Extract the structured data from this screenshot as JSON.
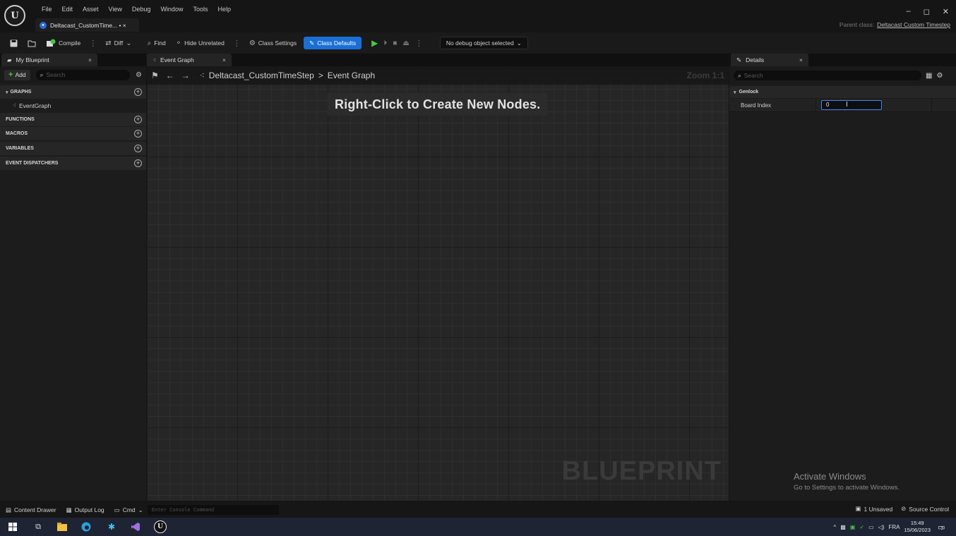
{
  "app": {
    "logo_text": "U",
    "menu": [
      "File",
      "Edit",
      "Asset",
      "View",
      "Debug",
      "Window",
      "Tools",
      "Help"
    ],
    "document_tab": "Deltacast_CustomTime... • ×",
    "parent_class_label": "Parent class:",
    "parent_class_value": "Deltacast Custom Timestep",
    "window_controls": {
      "minimize": "–",
      "restore": "◻",
      "close": "✕"
    }
  },
  "toolbar": {
    "compile": "Compile",
    "diff": "Diff",
    "find": "Find",
    "hide_unrelated": "Hide Unrelated",
    "class_settings": "Class Settings",
    "class_defaults": "Class Defaults",
    "debug_object": "No debug object selected"
  },
  "left_panel": {
    "tab": "My Blueprint",
    "add": "Add",
    "search_placeholder": "Search",
    "sections": {
      "graphs": "GRAPHS",
      "event_graph_item": "EventGraph",
      "functions": "FUNCTIONS",
      "macros": "MACROS",
      "variables": "VARIABLES",
      "event_dispatchers": "EVENT DISPATCHERS"
    }
  },
  "graph": {
    "tab": "Event Graph",
    "breadcrumb_root": "Deltacast_CustomTimeStep",
    "breadcrumb_sep": ">",
    "breadcrumb_leaf": "Event Graph",
    "zoom": "Zoom 1:1",
    "hint": "Right-Click to Create New Nodes.",
    "watermark": "BLUEPRINT"
  },
  "details": {
    "tab": "Details",
    "search_placeholder": "Search",
    "category": "Genlock",
    "property_name": "Board Index",
    "property_value": "0",
    "activate_title": "Activate Windows",
    "activate_sub": "Go to Settings to activate Windows."
  },
  "statusbar": {
    "content_drawer": "Content Drawer",
    "output_log": "Output Log",
    "cmd": "Cmd",
    "console_placeholder": "Enter Console Command",
    "unsaved": "1 Unsaved",
    "source_control": "Source Control"
  },
  "taskbar": {
    "language": "FRA",
    "time": "15:49",
    "date": "15/06/2023",
    "notifications": "3"
  }
}
